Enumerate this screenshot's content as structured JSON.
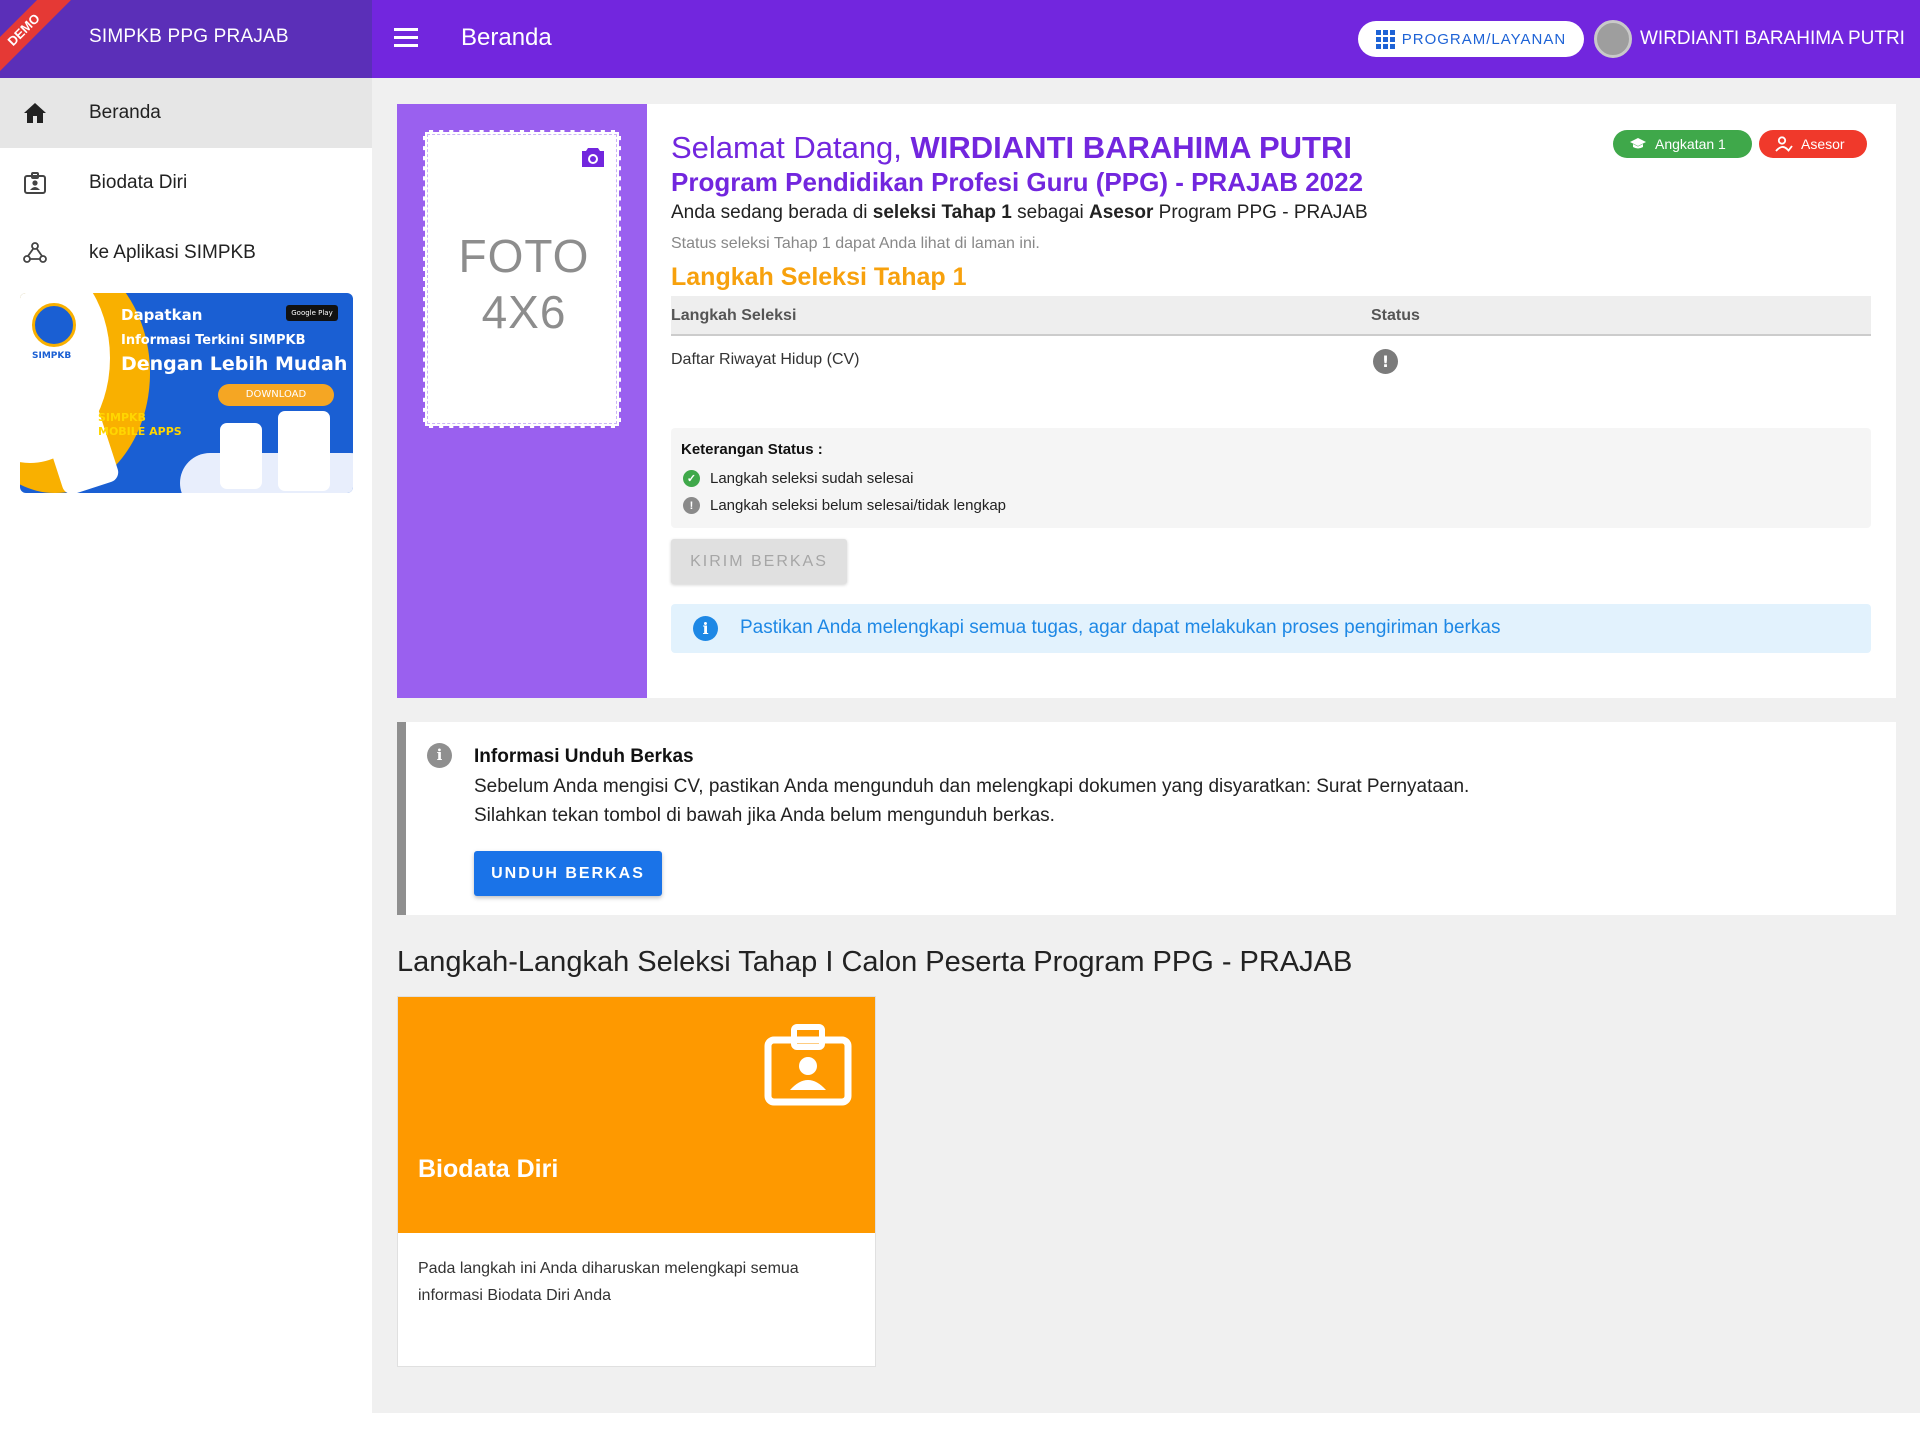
{
  "app": {
    "brand": "SIMPKB PPG PRAJAB",
    "demo_label": "DEMO"
  },
  "header": {
    "title": "Beranda",
    "program_button": "PROGRAM/LAYANAN",
    "user_name": "WIRDIANTI BARAHIMA PUTRI"
  },
  "sidebar": {
    "items": [
      {
        "label": "Beranda",
        "icon": "home-icon",
        "active": true
      },
      {
        "label": "Biodata Diri",
        "icon": "id-badge-icon"
      },
      {
        "label": "ke Aplikasi SIMPKB",
        "icon": "webhook-icon"
      }
    ],
    "banner": {
      "logo_text": "SIMPKB",
      "line1": "Dapatkan",
      "line2": "Informasi Terkini SIMPKB",
      "line3": "Dengan Lebih Mudah",
      "download": "DOWNLOAD",
      "apps": "SIMPKB MOBILE APPS",
      "store": "Google Play"
    }
  },
  "welcome": {
    "photo_placeholder_l1": "FOTO",
    "photo_placeholder_l2": "4X6",
    "greeting_prefix": "Selamat Datang, ",
    "greeting_name": "WIRDIANTI BARAHIMA PUTRI",
    "program": "Program Pendidikan Profesi Guru (PPG) - PRAJAB 2022",
    "seleksi_parts": [
      "Anda sedang berada di ",
      "seleksi Tahap 1",
      " sebagai ",
      "Asesor",
      " Program PPG - PRAJAB"
    ],
    "status_note": "Status seleksi Tahap 1 dapat Anda lihat di laman ini.",
    "langkah_title": "Langkah Seleksi Tahap 1",
    "badges": {
      "angkatan": "Angkatan 1",
      "asesor": "Asesor"
    },
    "table": {
      "headers": [
        "Langkah Seleksi",
        "Status"
      ],
      "rows": [
        {
          "step": "Daftar Riwayat Hidup (CV)",
          "status": "!"
        }
      ]
    },
    "legend": {
      "title": "Keterangan Status :",
      "done": "Langkah seleksi sudah selesai",
      "pending": "Langkah seleksi belum selesai/tidak lengkap"
    },
    "kirim_button": "KIRIM BERKAS",
    "info_alert": "Pastikan Anda melengkapi semua tugas, agar dapat melakukan proses pengiriman berkas"
  },
  "unduh": {
    "title": "Informasi Unduh Berkas",
    "line1": "Sebelum Anda mengisi CV, pastikan Anda mengunduh dan melengkapi dokumen yang disyaratkan: Surat Pernyataan.",
    "line2": "Silahkan tekan tombol di bawah jika Anda belum mengunduh berkas.",
    "button": "UNDUH BERKAS"
  },
  "steps": {
    "section_title": "Langkah-Langkah Seleksi Tahap I Calon Peserta Program PPG - PRAJAB",
    "cards": [
      {
        "title": "Biodata Diri",
        "description": "Pada langkah ini Anda diharuskan melengkapi semua informasi Biodata Diri Anda",
        "color": "#fe9900",
        "icon": "id-badge-icon"
      }
    ]
  },
  "colors": {
    "primary": "#7226de",
    "brand_dark": "#5b2fb8",
    "accent_orange": "#fe9900",
    "success": "#3fa84a",
    "danger": "#f0392b",
    "info": "#1e88e5"
  }
}
